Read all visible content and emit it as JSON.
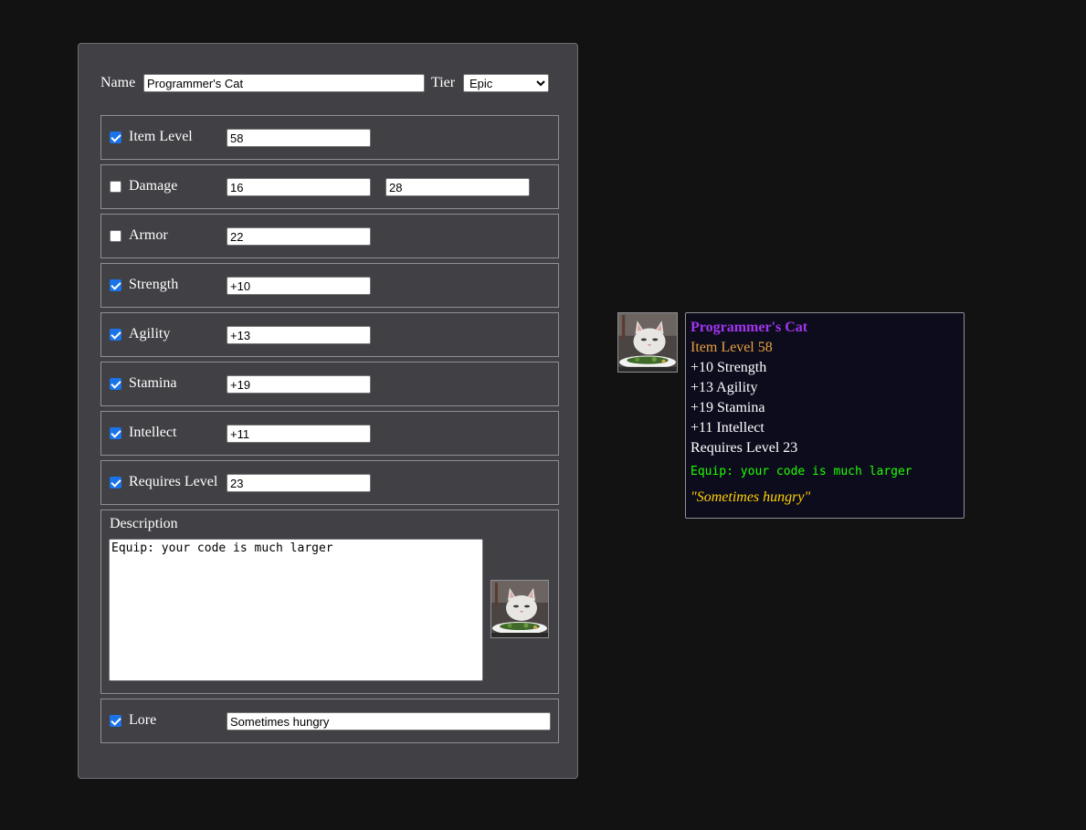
{
  "form": {
    "name_label": "Name",
    "name_value": "Programmer's Cat",
    "tier_label": "Tier",
    "tier_value": "Epic",
    "tier_options": [
      "Epic"
    ],
    "rows": [
      {
        "label": "Item Level",
        "checked": true,
        "values": [
          "58"
        ]
      },
      {
        "label": "Damage",
        "checked": false,
        "values": [
          "16",
          "28"
        ]
      },
      {
        "label": "Armor",
        "checked": false,
        "values": [
          "22"
        ]
      },
      {
        "label": "Strength",
        "checked": true,
        "values": [
          "+10"
        ]
      },
      {
        "label": "Agility",
        "checked": true,
        "values": [
          "+13"
        ]
      },
      {
        "label": "Stamina",
        "checked": true,
        "values": [
          "+19"
        ]
      },
      {
        "label": "Intellect",
        "checked": true,
        "values": [
          "+11"
        ]
      },
      {
        "label": "Requires Level",
        "checked": true,
        "values": [
          "23"
        ]
      }
    ],
    "description_label": "Description",
    "description_value": "Equip: your code is much larger",
    "lore": {
      "label": "Lore",
      "checked": true,
      "value": "Sometimes hungry"
    }
  },
  "tooltip": {
    "name": "Programmer's Cat",
    "item_level": "Item Level 58",
    "stats": [
      "+10 Strength",
      "+13 Agility",
      "+19 Stamina",
      "+11 Intellect"
    ],
    "requires": "Requires Level 23",
    "equip": "Equip: your code is much larger",
    "lore": "\"Sometimes hungry\""
  },
  "colors": {
    "epic": "#a335ee",
    "item_level": "#e6a23c",
    "equip": "#1eff00",
    "lore": "#ffd100"
  },
  "icons": {
    "item_image": "cat-at-dinner-table-image"
  }
}
